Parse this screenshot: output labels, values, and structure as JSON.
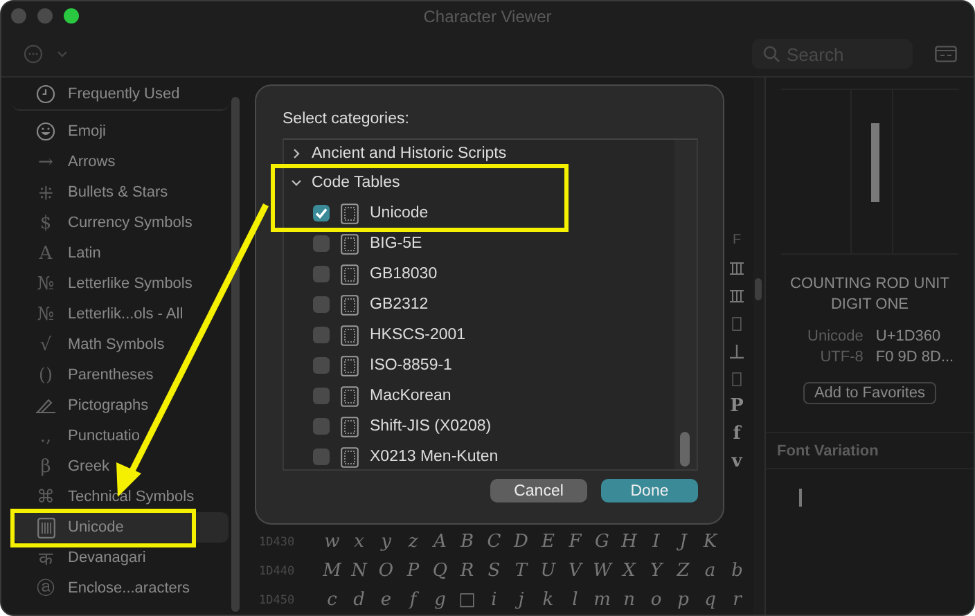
{
  "window": {
    "title": "Character Viewer"
  },
  "toolbar": {
    "search": {
      "placeholder": "Search"
    }
  },
  "sidebar": {
    "items": [
      {
        "label": "Frequently Used",
        "kind": "clock",
        "selected": false
      },
      {
        "label": "Emoji",
        "kind": "smiley",
        "selected": false
      },
      {
        "label": "Arrows",
        "kind": "glyph",
        "glyph": "→",
        "selected": false
      },
      {
        "label": "Bullets & Stars",
        "kind": "glyph",
        "glyph": "⁜",
        "selected": false
      },
      {
        "label": "Currency Symbols",
        "kind": "glyph",
        "glyph": "$",
        "selected": false
      },
      {
        "label": "Latin",
        "kind": "glyph",
        "glyph": "A",
        "selected": false
      },
      {
        "label": "Letterlike Symbols",
        "kind": "glyph",
        "glyph": "№",
        "selected": false
      },
      {
        "label": "Letterlik...ols - All",
        "kind": "glyph",
        "glyph": "№",
        "selected": false
      },
      {
        "label": "Math Symbols",
        "kind": "glyph",
        "glyph": "√",
        "selected": false
      },
      {
        "label": "Parentheses",
        "kind": "glyph",
        "glyph": "()",
        "selected": false
      },
      {
        "label": "Pictographs",
        "kind": "pen",
        "selected": false
      },
      {
        "label": "Punctuatio",
        "kind": "glyph",
        "glyph": ".,",
        "selected": false
      },
      {
        "label": "Greek",
        "kind": "glyph",
        "glyph": "β",
        "selected": false
      },
      {
        "label": "Technical Symbols",
        "kind": "glyph",
        "glyph": "⌘",
        "selected": false
      },
      {
        "label": "Unicode",
        "kind": "grid",
        "selected": true
      },
      {
        "label": "Devanagari",
        "kind": "glyph",
        "glyph": "क",
        "selected": false
      },
      {
        "label": "Enclose...aracters",
        "kind": "glyph",
        "glyph": "ⓐ",
        "selected": false
      }
    ]
  },
  "dialog": {
    "title": "Select categories:",
    "groups": [
      {
        "label": "Ancient and Historic Scripts",
        "expanded": false
      },
      {
        "label": "Code Tables",
        "expanded": true,
        "children": [
          {
            "label": "Unicode",
            "checked": true
          },
          {
            "label": "BIG-5E",
            "checked": false
          },
          {
            "label": "GB18030",
            "checked": false
          },
          {
            "label": "GB2312",
            "checked": false
          },
          {
            "label": "HKSCS-2001",
            "checked": false
          },
          {
            "label": "ISO-8859-1",
            "checked": false
          },
          {
            "label": "MacKorean",
            "checked": false
          },
          {
            "label": "Shift-JIS (X0208)",
            "checked": false
          },
          {
            "label": "X0213 Men-Kuten",
            "checked": false
          }
        ]
      }
    ],
    "buttons": [
      {
        "label": "Cancel",
        "kind": "secondary"
      },
      {
        "label": "Done",
        "kind": "primary"
      }
    ]
  },
  "strip": {
    "header": "F",
    "cells": [
      {
        "kind": "rods"
      },
      {
        "kind": "rods"
      },
      {
        "kind": "box"
      },
      {
        "kind": "tack"
      },
      {
        "kind": "box"
      },
      {
        "kind": "text",
        "text": "P"
      },
      {
        "kind": "text",
        "text": "f"
      },
      {
        "kind": "text",
        "text": "v"
      }
    ]
  },
  "grid": {
    "rows": [
      {
        "code": "1D430",
        "chars": [
          "w",
          "x",
          "y",
          "z",
          "A",
          "B",
          "C",
          "D",
          "E",
          "F",
          "G",
          "H",
          "I",
          "J",
          "K"
        ]
      },
      {
        "code": "1D440",
        "chars": [
          "M",
          "N",
          "O",
          "P",
          "Q",
          "R",
          "S",
          "T",
          "U",
          "V",
          "W",
          "X",
          "Y",
          "Z",
          "a",
          "b"
        ]
      },
      {
        "code": "1D450",
        "chars": [
          "c",
          "d",
          "e",
          "f",
          "g",
          "□",
          "i",
          "j",
          "k",
          "l",
          "m",
          "n",
          "o",
          "p",
          "q",
          "r"
        ]
      }
    ]
  },
  "detail": {
    "name": "COUNTING ROD UNIT DIGIT ONE",
    "codes": [
      {
        "label": "Unicode",
        "value": "U+1D360"
      },
      {
        "label": "UTF-8",
        "value": "F0 9D 8D..."
      }
    ],
    "favorite_button": "Add to Favorites",
    "font_variation": "Font Variation"
  }
}
